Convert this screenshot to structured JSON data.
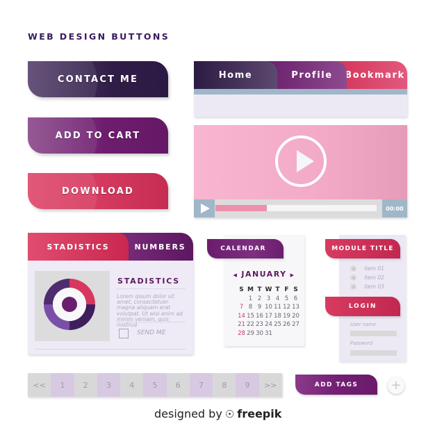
{
  "title": "WEB DESIGN BUTTONS",
  "buttons": {
    "contact": "CONTACT ME",
    "cart": "ADD TO CART",
    "download": "DOWNLOAD"
  },
  "nav_tabs": [
    "Home",
    "Profile",
    "Bookmark"
  ],
  "video": {
    "time": "00:00",
    "progress_percent": 32,
    "colors": {
      "background": "#f4b0cb",
      "controls": "#9fb7c8",
      "progress": "#ee8fab"
    }
  },
  "stats_panel": {
    "tabs": [
      "STADISTICS",
      "NUMBERS"
    ],
    "heading": "STADISTICS",
    "lorem": "Lorem ipsum dolor sit amet, consectetuer magna aliquam erat volutpat. Ut wisi enim ad minim veniam, quis nostrud",
    "checkbox_label": "SEND ME",
    "donut": {
      "segments": [
        {
          "name": "top-right",
          "share": 25,
          "color": "#d8375f"
        },
        {
          "name": "bottom-right",
          "share": 25,
          "color": "#3e1f5c"
        },
        {
          "name": "bottom-left",
          "share": 25,
          "color": "#7a4fa8"
        },
        {
          "name": "top-left",
          "share": 25,
          "color": "#4f2c6e"
        }
      ],
      "center_color": "#6c1e6e"
    }
  },
  "calendar": {
    "tab_label": "CALENDAR",
    "prev": "◀",
    "next": "▶",
    "month": "JANUARY",
    "day_headers": [
      "S",
      "M",
      "T",
      "W",
      "T",
      "F",
      "S"
    ],
    "weeks": [
      [
        "",
        "1",
        "2",
        "3",
        "4",
        "5",
        "6"
      ],
      [
        "7",
        "8",
        "9",
        "10",
        "11",
        "12",
        "13"
      ],
      [
        "14",
        "15",
        "16",
        "17",
        "18",
        "19",
        "20"
      ],
      [
        "21",
        "22",
        "23",
        "24",
        "25",
        "26",
        "27"
      ],
      [
        "28",
        "29",
        "30",
        "31",
        "",
        "",
        ""
      ]
    ]
  },
  "module": {
    "title": "MODULE TITLE",
    "items": [
      "item 01",
      "item 02",
      "item 03"
    ],
    "login_title": "LOGIN",
    "username_label": "User name",
    "password_label": "Password"
  },
  "pagination": [
    "<<",
    "1",
    "2",
    "3",
    "4",
    "5",
    "6",
    "7",
    "8",
    "9",
    ">>"
  ],
  "add_tags": "ADD TAGS",
  "plus": "+",
  "credit": {
    "prefix": "designed by",
    "logo": "freepik-logo",
    "brand": "freepik"
  }
}
